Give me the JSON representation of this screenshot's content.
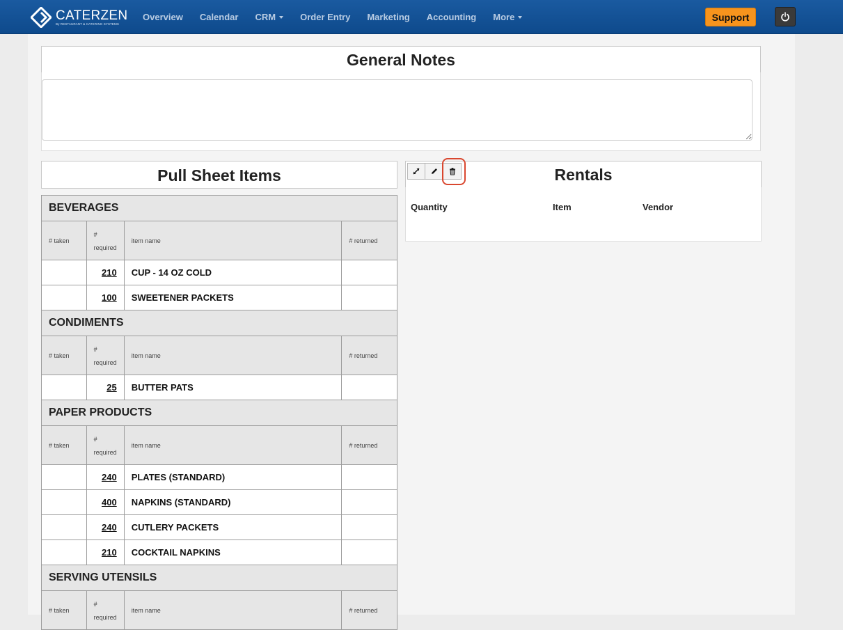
{
  "nav": {
    "brand": {
      "name": "CATERZEN",
      "tagline": "By RESTAURANT & CATERING SYSTEMS"
    },
    "items": [
      {
        "label": "Overview",
        "dropdown": false
      },
      {
        "label": "Calendar",
        "dropdown": false
      },
      {
        "label": "CRM",
        "dropdown": true
      },
      {
        "label": "Order Entry",
        "dropdown": false
      },
      {
        "label": "Marketing",
        "dropdown": false
      },
      {
        "label": "Accounting",
        "dropdown": false
      },
      {
        "label": "More",
        "dropdown": true
      }
    ],
    "support_label": "Support",
    "power_icon": "power-icon"
  },
  "general_notes": {
    "title": "General Notes",
    "value": ""
  },
  "pull_sheet": {
    "title": "Pull Sheet Items",
    "columns": {
      "taken": "# taken",
      "required_1": "#",
      "required_2": "required",
      "name": "item name",
      "returned": "# returned"
    },
    "categories": [
      {
        "name": "BEVERAGES",
        "items": [
          {
            "required": "210",
            "name": "CUP - 14 OZ COLD"
          },
          {
            "required": "100",
            "name": "SWEETENER PACKETS"
          }
        ]
      },
      {
        "name": "CONDIMENTS",
        "items": [
          {
            "required": "25",
            "name": "BUTTER PATS"
          }
        ]
      },
      {
        "name": "PAPER PRODUCTS",
        "items": [
          {
            "required": "240",
            "name": "PLATES (STANDARD)"
          },
          {
            "required": "400",
            "name": "NAPKINS (STANDARD)"
          },
          {
            "required": "240",
            "name": "CUTLERY PACKETS"
          },
          {
            "required": "210",
            "name": "COCKTAIL NAPKINS"
          }
        ]
      },
      {
        "name": "SERVING UTENSILS",
        "items": []
      }
    ]
  },
  "rentals": {
    "title": "Rentals",
    "toolbar": [
      "expand-icon",
      "pencil-icon",
      "trash-icon"
    ],
    "columns": {
      "quantity": "Quantity",
      "item": "Item",
      "vendor": "Vendor"
    }
  },
  "colors": {
    "navbar": "#0e4a8c",
    "support": "#f7941d",
    "highlight": "#d9472f"
  }
}
